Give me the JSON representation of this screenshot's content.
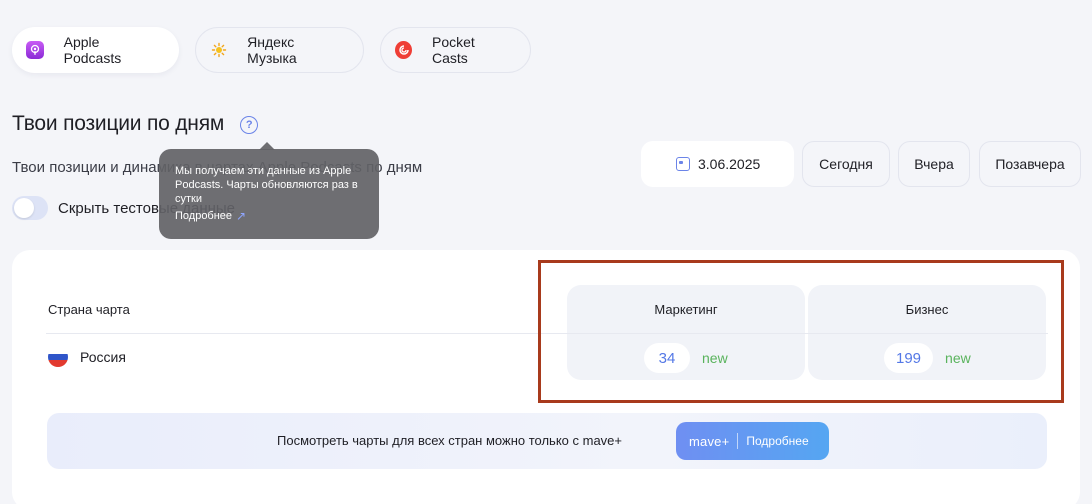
{
  "platforms": [
    {
      "label": "Apple Podcasts",
      "icon": "apple-podcasts-icon",
      "active": true
    },
    {
      "label": "Яндекс Музыка",
      "icon": "yandex-music-icon",
      "active": false
    },
    {
      "label": "Pocket Casts",
      "icon": "pocket-casts-icon",
      "active": false
    }
  ],
  "heading": {
    "title": "Твои позиции по дням",
    "help_glyph": "?"
  },
  "subtitle": "Твои позиции и динамика в чартах Apple Podcasts по дням",
  "toggle": {
    "label": "Скрыть тестовые данные",
    "on": false
  },
  "tooltip": {
    "text": "Мы получаем эти данные из Apple Podcasts. Чарты обновляются раз в сутки",
    "link": "Подробнее"
  },
  "date_picker": {
    "value": "3.06.2025"
  },
  "quick_dates": [
    "Сегодня",
    "Вчера",
    "Позавчера"
  ],
  "table": {
    "country_header": "Страна чарта",
    "categories": [
      {
        "name": "Маркетинг",
        "position": "34",
        "status": "new"
      },
      {
        "name": "Бизнес",
        "position": "199",
        "status": "new"
      }
    ],
    "rows": [
      {
        "country": "Россия",
        "flag": "russia-flag"
      }
    ]
  },
  "banner": {
    "text": "Посмотреть чарты для всех стран можно только с mave+",
    "logo": "mave+",
    "button": "Подробнее"
  },
  "colors": {
    "accent": "#6b84e8",
    "position": "#5478e6",
    "new": "#59b35c",
    "highlight": "#a83a1c"
  }
}
